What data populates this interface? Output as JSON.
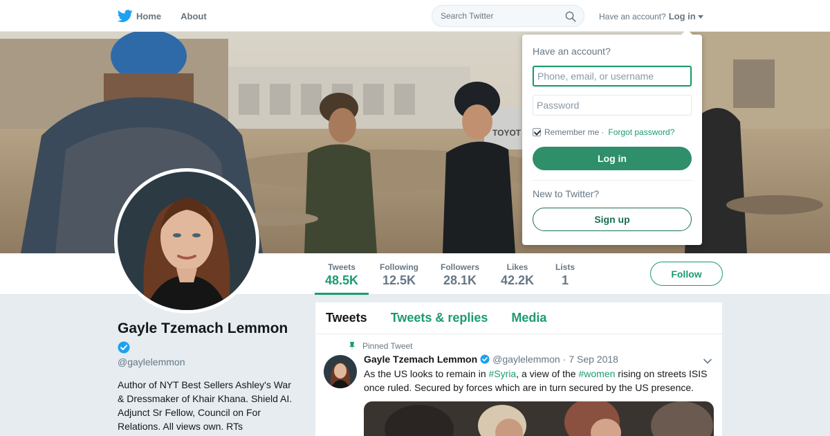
{
  "nav": {
    "home_label": "Home",
    "about_label": "About",
    "search_placeholder": "Search Twitter",
    "have_account": "Have an account?",
    "login_label": "Log in"
  },
  "banner": {
    "vehicle_text": "TOYOT"
  },
  "profile": {
    "name": "Gayle Tzemach Lemmon",
    "handle": "@gaylelemmon",
    "bio": "Author of NYT Best Sellers Ashley's War & Dressmaker of Khair Khana. Shield AI. Adjunct Sr Fellow, Council on For Relations. All views own. RTs"
  },
  "stats": [
    {
      "label": "Tweets",
      "value": "48.5K"
    },
    {
      "label": "Following",
      "value": "12.5K"
    },
    {
      "label": "Followers",
      "value": "28.1K"
    },
    {
      "label": "Likes",
      "value": "42.2K"
    },
    {
      "label": "Lists",
      "value": "1"
    }
  ],
  "follow_label": "Follow",
  "timeline": {
    "tabs": [
      {
        "label": "Tweets"
      },
      {
        "label": "Tweets & replies"
      },
      {
        "label": "Media"
      }
    ],
    "pinned_label": "Pinned Tweet",
    "tweet": {
      "name": "Gayle Tzemach Lemmon",
      "handle": "@gaylelemmon",
      "separator": "·",
      "date": "7 Sep 2018",
      "text_1": "As the US looks to remain in ",
      "hashtag_1": "#Syria",
      "text_2": ", a view of the ",
      "hashtag_2": "#women",
      "text_3": " rising on streets ISIS once ruled. Secured by forces which are in turn secured by the US presence."
    }
  },
  "login_dropdown": {
    "title": "Have an account?",
    "username_placeholder": "Phone, email, or username",
    "password_placeholder": "Password",
    "remember_label": "Remember me",
    "separator": "·",
    "forgot_label": "Forgot password?",
    "login_button": "Log in",
    "new_label": "New to Twitter?",
    "signup_button": "Sign up"
  },
  "colors": {
    "accent": "#1b9b6f",
    "twitter_blue": "#1da1f2",
    "verified": "#1da1f2"
  }
}
